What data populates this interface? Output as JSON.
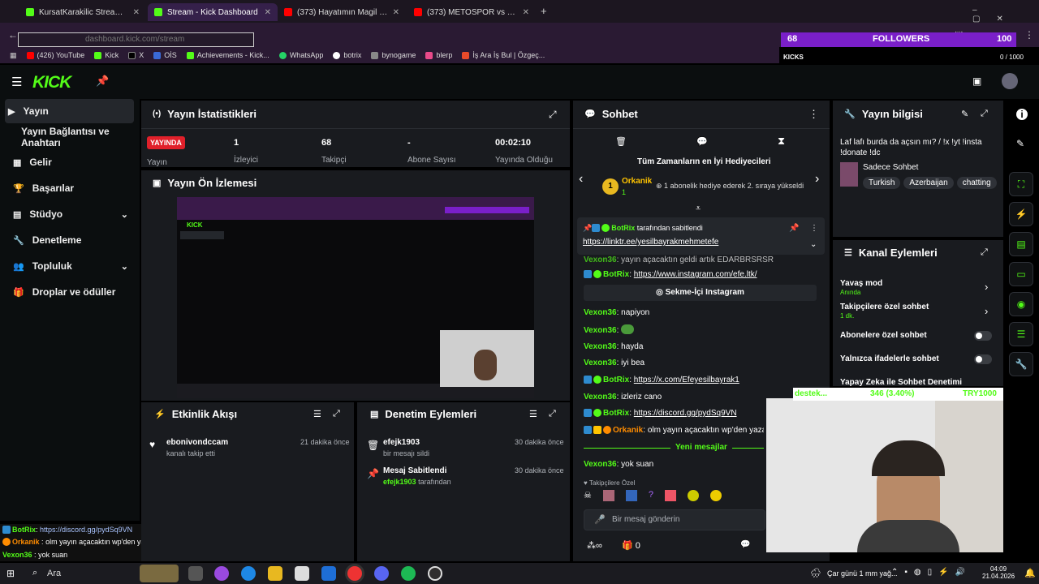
{
  "browser": {
    "tabs": [
      {
        "label": "KursatKarakilic Stream - Watch",
        "icon": "kick-favicon"
      },
      {
        "label": "Stream - Kick Dashboard",
        "icon": "kick-favicon"
      },
      {
        "label": "(373) Hayatımın Magil VIP'te Ba",
        "icon": "youtube-favicon"
      },
      {
        "label": "(373) METOSPOR vs KADİM FU",
        "icon": "youtube-favicon"
      }
    ],
    "new_tab": "+",
    "url": "dashboard.kick.com/stream",
    "bookmarks": [
      "(426) YouTube",
      "Kick",
      "X",
      "OİS",
      "Achievements - Kick...",
      "WhatsApp",
      "botrix",
      "bynogame",
      "blerp",
      "İş Ara İş Bul | Özgeç..."
    ]
  },
  "overlay": {
    "follower_count": "68",
    "followers_label": "FOLLOWERS",
    "goal_count": "100",
    "kicks_label": "KICKS",
    "kicks_goal": "0 / 1000",
    "donation_label": "destek...",
    "donation_amount": "346 (3.40%)",
    "donation_goal": "TRY1000"
  },
  "sidebar": {
    "items": [
      {
        "label": "Yayın"
      },
      {
        "label": "Yayın Bağlantısı ve Anahtarı"
      },
      {
        "label": "Gelir"
      },
      {
        "label": "Başarılar"
      },
      {
        "label": "Stüdyo"
      },
      {
        "label": "Denetleme"
      },
      {
        "label": "Topluluk"
      },
      {
        "label": "Droplar ve ödüller"
      }
    ]
  },
  "stats": {
    "title": "Yayın İstatistikleri",
    "live_badge": "YAYINDA",
    "live_label": "Yayın",
    "items": [
      {
        "value": "1",
        "label": "İzleyici"
      },
      {
        "value": "68",
        "label": "Takipçi"
      },
      {
        "value": "-",
        "label": "Abone Sayısı"
      },
      {
        "value": "00:02:10",
        "label": "Yayında Olduğu"
      }
    ]
  },
  "preview": {
    "title": "Yayın Ön İzlemesi"
  },
  "activity": {
    "title": "Etkinlik Akışı",
    "items": [
      {
        "user": "ebonivondccam",
        "text": "kanalı takip etti",
        "time": "21 dakika önce"
      }
    ]
  },
  "moderation": {
    "title": "Denetim Eylemleri",
    "items": [
      {
        "user": "efejk1903",
        "text": "bir mesajı sildi",
        "time": "30 dakika önce"
      },
      {
        "user": "Mesaj Sabitlendi",
        "by": "efejk1903",
        "by_suffix": "tarafından",
        "time": "30 dakika önce"
      }
    ]
  },
  "chat": {
    "title": "Sohbet",
    "top_gifters_title": "Tüm Zamanların en İyi Hediyecileri",
    "gifter_name": "Orkanik",
    "gifter_count": "1",
    "gifter_rank": "1",
    "gifter_note": "1 abonelik hediye ederek 2. sıraya yükseldi",
    "pinned_by": "BotRix",
    "pinned_suffix": "tarafından sabitlendi",
    "pinned_link": "https://linktr.ee/yesilbayrakmehmetefe",
    "messages": [
      {
        "user": "Vexon36",
        "sep": ":",
        "text": "yayın açacaktın geldi artık EDARBRSRSR"
      },
      {
        "user": "BotRix",
        "sep": ":",
        "link": "https://www.instagram.com/efe.ltk/"
      },
      {
        "system": "Sekme-İçi Instagram"
      },
      {
        "user": "Vexon36",
        "sep": ":",
        "text": "napiyon"
      },
      {
        "user": "Vexon36",
        "sep": ":",
        "text": ""
      },
      {
        "user": "Vexon36",
        "sep": ":",
        "text": "hayda"
      },
      {
        "user": "Vexon36",
        "sep": ":",
        "text": "iyi bea"
      },
      {
        "user": "BotRix",
        "sep": ":",
        "link": "https://x.com/Efeyesilbayrak1"
      },
      {
        "user": "Vexon36",
        "sep": ":",
        "text": "izleriz cano"
      },
      {
        "user": "BotRix",
        "sep": ":",
        "link": "https://discord.gg/pydSq9VN"
      },
      {
        "user": "Orkanik",
        "sep": ":",
        "text": "olm yayın açacaktın wp'den yazaydın"
      }
    ],
    "new_messages": "Yeni mesajlar",
    "last_message": {
      "user": "Vexon36",
      "sep": ":",
      "text": "yok suan"
    },
    "followers_only": "Takipçilere Özel",
    "input_placeholder": "Bir mesaj gönderin",
    "kicks_balance": "0",
    "infinity": "∞"
  },
  "stream_info": {
    "title": "Yayın bilgisi",
    "stream_title": "Laf lafı burda da açsın mı? / !x !yt !insta !donate !dc",
    "category": "Sadece Sohbet",
    "tags": [
      "Turkish",
      "Azerbaijan",
      "chatting"
    ]
  },
  "channel_actions": {
    "title": "Kanal Eylemleri",
    "items": [
      {
        "label": "Yavaş mod",
        "sub": "Anında",
        "control": "chevron"
      },
      {
        "label": "Takipçilere özel sohbet",
        "sub": "1 dk.",
        "control": "chevron"
      },
      {
        "label": "Abonelere özel sohbet",
        "sub": "",
        "control": "toggle"
      },
      {
        "label": "Yalnızca ifadelerle sohbet",
        "sub": "",
        "control": "toggle"
      },
      {
        "label": "Yapay Zeka ile Sohbet Denetimi",
        "sub": "",
        "control": "link"
      }
    ]
  },
  "stream_overlay_chat": [
    {
      "user": "BotRix",
      "sep": ":",
      "text": "https://discord.gg/pydSq9VN"
    },
    {
      "user": "Orkanik",
      "sep": ":",
      "text": "olm yayın açacaktın wp'den yazaydın ya"
    },
    {
      "user": "Vexon36",
      "sep": ":",
      "text": "yok suan"
    }
  ],
  "taskbar": {
    "search": "Ara",
    "weather": "Çar günü 1 mm yağ...",
    "time": "04:09",
    "date": "21.04.2026"
  },
  "colors": {
    "accent": "#53fc18",
    "live": "#e0202a",
    "followers_bar": "#7a1fc9",
    "panel": "#191b1f"
  }
}
